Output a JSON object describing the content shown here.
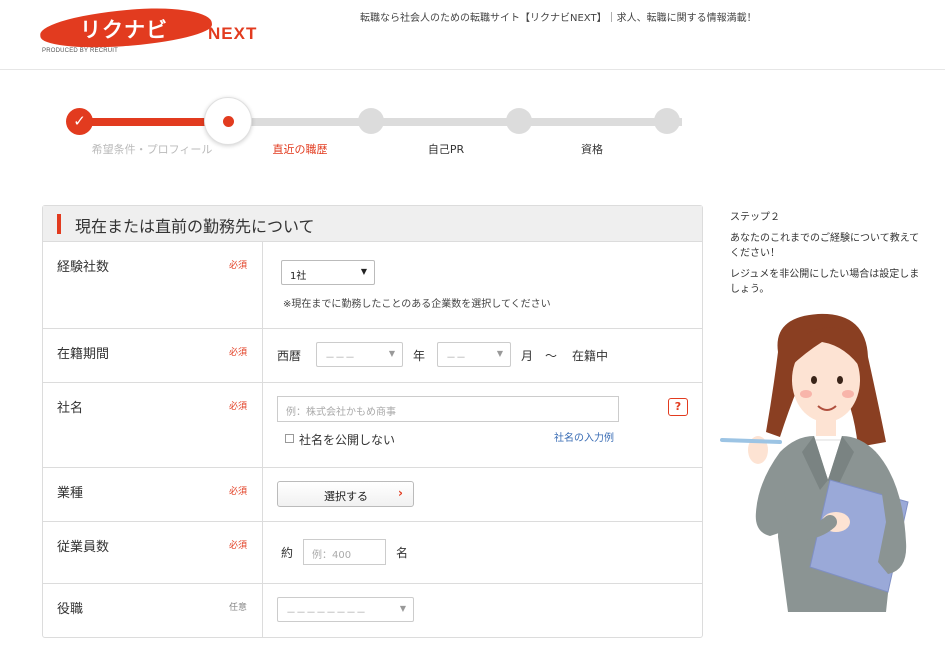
{
  "header": {
    "logo_text": "リクナビ",
    "logo_next": "NEXT",
    "logo_produced": "PRODUCED BY RECRUIT",
    "tagline": "転職なら社会人のための転職サイト【リクナビNEXT】｜求人、転職に関する情報満載！"
  },
  "stepper": {
    "check_glyph": "✓",
    "steps": [
      {
        "label": "希望条件・プロフィール",
        "state": "done"
      },
      {
        "label": "直近の職歴",
        "state": "current"
      },
      {
        "label": "自己PR",
        "state": "todo"
      },
      {
        "label": "資格",
        "state": "todo"
      }
    ],
    "active_color": "#e23b1f",
    "inactive_color": "#dcdcdc"
  },
  "form": {
    "title": "現在または直前の勤務先について",
    "required_label": "必須",
    "optional_label": "任意",
    "rows": {
      "experience_count": {
        "label": "経験社数",
        "value": "1社",
        "note": "※現在までに勤務したことのある企業数を選択してください"
      },
      "tenure": {
        "label": "在籍期間",
        "era": "西暦",
        "year_placeholder": "－－－",
        "year_unit": "年",
        "month_placeholder": "－－",
        "month_unit": "月",
        "tilde": "〜",
        "current": "在籍中"
      },
      "company": {
        "label": "社名",
        "placeholder": "例：株式会社かもめ商事",
        "help": "?",
        "hide_label": "社名を公開しない",
        "example_link": "社名の入力例"
      },
      "industry": {
        "label": "業種",
        "button": "選択する",
        "chevron": "›"
      },
      "employees": {
        "label": "従業員数",
        "prefix": "約",
        "placeholder": "例：400",
        "unit": "名"
      },
      "position": {
        "label": "役職",
        "placeholder": "－－－－－－－－"
      }
    },
    "select_arrow": "▼"
  },
  "side": {
    "step": "ステップ２",
    "message1": "あなたのこれまでのご経験について教えてください！",
    "message2": "レジュメを非公開にしたい場合は設定しましょう。"
  }
}
